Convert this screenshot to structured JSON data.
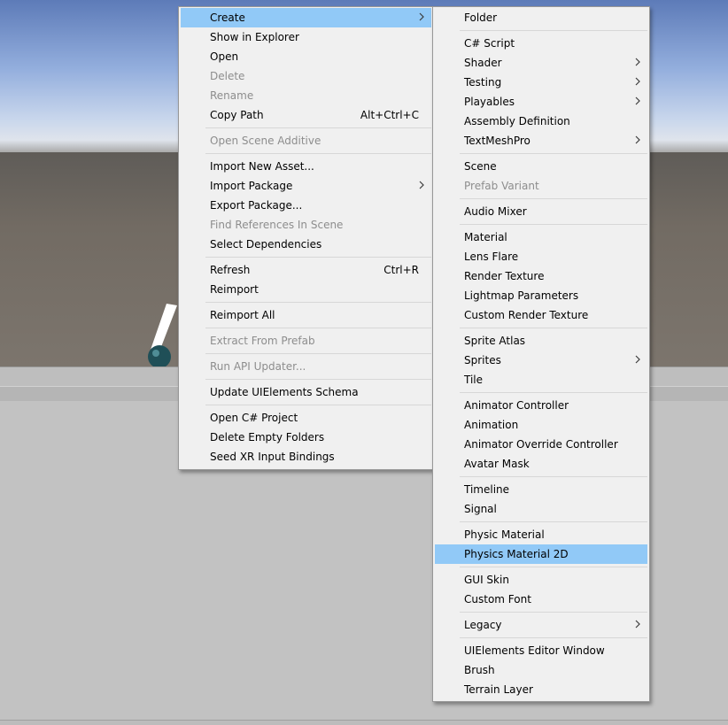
{
  "main_menu": {
    "items": [
      {
        "label": "Create",
        "shortcut": "",
        "submenu": true,
        "disabled": false,
        "highlighted": true
      },
      {
        "label": "Show in Explorer",
        "shortcut": "",
        "submenu": false,
        "disabled": false
      },
      {
        "label": "Open",
        "shortcut": "",
        "submenu": false,
        "disabled": false
      },
      {
        "label": "Delete",
        "shortcut": "",
        "submenu": false,
        "disabled": true
      },
      {
        "label": "Rename",
        "shortcut": "",
        "submenu": false,
        "disabled": true
      },
      {
        "label": "Copy Path",
        "shortcut": "Alt+Ctrl+C",
        "submenu": false,
        "disabled": false
      },
      {
        "separator": true
      },
      {
        "label": "Open Scene Additive",
        "shortcut": "",
        "submenu": false,
        "disabled": true
      },
      {
        "separator": true
      },
      {
        "label": "Import New Asset...",
        "shortcut": "",
        "submenu": false,
        "disabled": false
      },
      {
        "label": "Import Package",
        "shortcut": "",
        "submenu": true,
        "disabled": false
      },
      {
        "label": "Export Package...",
        "shortcut": "",
        "submenu": false,
        "disabled": false
      },
      {
        "label": "Find References In Scene",
        "shortcut": "",
        "submenu": false,
        "disabled": true
      },
      {
        "label": "Select Dependencies",
        "shortcut": "",
        "submenu": false,
        "disabled": false
      },
      {
        "separator": true
      },
      {
        "label": "Refresh",
        "shortcut": "Ctrl+R",
        "submenu": false,
        "disabled": false
      },
      {
        "label": "Reimport",
        "shortcut": "",
        "submenu": false,
        "disabled": false
      },
      {
        "separator": true
      },
      {
        "label": "Reimport All",
        "shortcut": "",
        "submenu": false,
        "disabled": false
      },
      {
        "separator": true
      },
      {
        "label": "Extract From Prefab",
        "shortcut": "",
        "submenu": false,
        "disabled": true
      },
      {
        "separator": true
      },
      {
        "label": "Run API Updater...",
        "shortcut": "",
        "submenu": false,
        "disabled": true
      },
      {
        "separator": true
      },
      {
        "label": "Update UIElements Schema",
        "shortcut": "",
        "submenu": false,
        "disabled": false
      },
      {
        "separator": true
      },
      {
        "label": "Open C# Project",
        "shortcut": "",
        "submenu": false,
        "disabled": false
      },
      {
        "label": "Delete Empty Folders",
        "shortcut": "",
        "submenu": false,
        "disabled": false
      },
      {
        "label": "Seed XR Input Bindings",
        "shortcut": "",
        "submenu": false,
        "disabled": false
      }
    ]
  },
  "create_submenu": {
    "items": [
      {
        "label": "Folder",
        "submenu": false,
        "disabled": false
      },
      {
        "separator": true
      },
      {
        "label": "C# Script",
        "submenu": false,
        "disabled": false
      },
      {
        "label": "Shader",
        "submenu": true,
        "disabled": false
      },
      {
        "label": "Testing",
        "submenu": true,
        "disabled": false
      },
      {
        "label": "Playables",
        "submenu": true,
        "disabled": false
      },
      {
        "label": "Assembly Definition",
        "submenu": false,
        "disabled": false
      },
      {
        "label": "TextMeshPro",
        "submenu": true,
        "disabled": false
      },
      {
        "separator": true
      },
      {
        "label": "Scene",
        "submenu": false,
        "disabled": false
      },
      {
        "label": "Prefab Variant",
        "submenu": false,
        "disabled": true
      },
      {
        "separator": true
      },
      {
        "label": "Audio Mixer",
        "submenu": false,
        "disabled": false
      },
      {
        "separator": true
      },
      {
        "label": "Material",
        "submenu": false,
        "disabled": false
      },
      {
        "label": "Lens Flare",
        "submenu": false,
        "disabled": false
      },
      {
        "label": "Render Texture",
        "submenu": false,
        "disabled": false
      },
      {
        "label": "Lightmap Parameters",
        "submenu": false,
        "disabled": false
      },
      {
        "label": "Custom Render Texture",
        "submenu": false,
        "disabled": false
      },
      {
        "separator": true
      },
      {
        "label": "Sprite Atlas",
        "submenu": false,
        "disabled": false
      },
      {
        "label": "Sprites",
        "submenu": true,
        "disabled": false
      },
      {
        "label": "Tile",
        "submenu": false,
        "disabled": false
      },
      {
        "separator": true
      },
      {
        "label": "Animator Controller",
        "submenu": false,
        "disabled": false
      },
      {
        "label": "Animation",
        "submenu": false,
        "disabled": false
      },
      {
        "label": "Animator Override Controller",
        "submenu": false,
        "disabled": false
      },
      {
        "label": "Avatar Mask",
        "submenu": false,
        "disabled": false
      },
      {
        "separator": true
      },
      {
        "label": "Timeline",
        "submenu": false,
        "disabled": false
      },
      {
        "label": "Signal",
        "submenu": false,
        "disabled": false
      },
      {
        "separator": true
      },
      {
        "label": "Physic Material",
        "submenu": false,
        "disabled": false
      },
      {
        "label": "Physics Material 2D",
        "submenu": false,
        "disabled": false,
        "highlighted": true
      },
      {
        "separator": true
      },
      {
        "label": "GUI Skin",
        "submenu": false,
        "disabled": false
      },
      {
        "label": "Custom Font",
        "submenu": false,
        "disabled": false
      },
      {
        "separator": true
      },
      {
        "label": "Legacy",
        "submenu": true,
        "disabled": false
      },
      {
        "separator": true
      },
      {
        "label": "UIElements Editor Window",
        "submenu": false,
        "disabled": false
      },
      {
        "label": "Brush",
        "submenu": false,
        "disabled": false
      },
      {
        "label": "Terrain Layer",
        "submenu": false,
        "disabled": false
      }
    ]
  },
  "colors": {
    "menu_bg": "#f0f0f0",
    "highlight": "#91c9f7",
    "disabled_text": "#8d8d8d",
    "separator": "#d7d7d7"
  },
  "icons": {
    "submenu_arrow": "chevron-right-icon"
  }
}
